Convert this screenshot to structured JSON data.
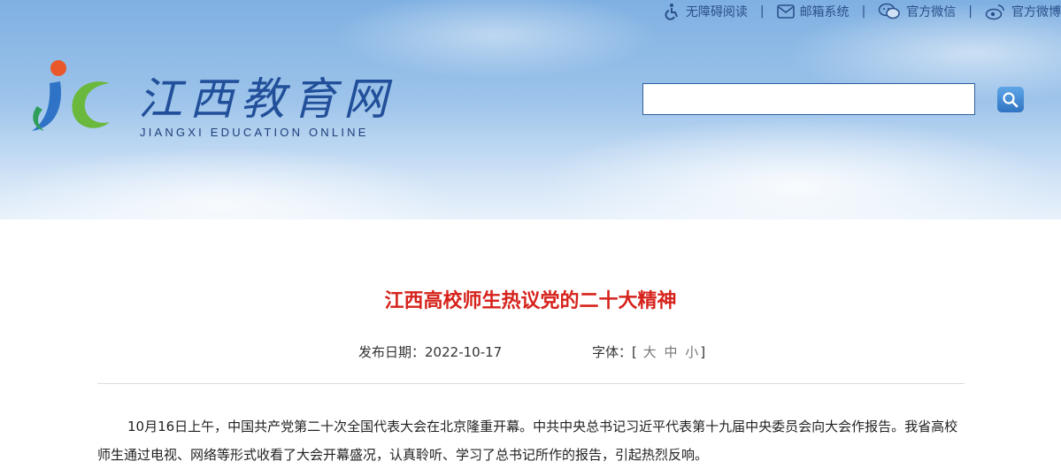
{
  "topbar": {
    "accessibility": "无障碍阅读",
    "mail": "邮箱系统",
    "wechat": "官方微信",
    "weibo": "官方微博",
    "separator": "|"
  },
  "logo": {
    "cn": "江西教育网",
    "en": "JIANGXI EDUCATION ONLINE"
  },
  "search": {
    "value": "",
    "placeholder": ""
  },
  "article": {
    "title": "江西高校师生热议党的二十大精神",
    "date_label": "发布日期：",
    "date": "2022-10-17",
    "font_label": "字体：",
    "font_open": "[",
    "font_large": "大",
    "font_medium": "中",
    "font_small": "小",
    "font_close": "]",
    "paragraph": "10月16日上午，中国共产党第二十次全国代表大会在北京隆重开幕。中共中央总书记习近平代表第十九届中央委员会向大会作报告。我省高校师生通过电视、网络等形式收看了大会开幕盛况，认真聆听、学习了总书记所作的报告，引起热烈反响。"
  },
  "colors": {
    "accent": "#d6231c",
    "brand_blue": "#214f99"
  },
  "icons": [
    "accessibility-icon",
    "mail-icon",
    "wechat-icon",
    "weibo-icon",
    "search-icon",
    "logo-mark-icon"
  ]
}
